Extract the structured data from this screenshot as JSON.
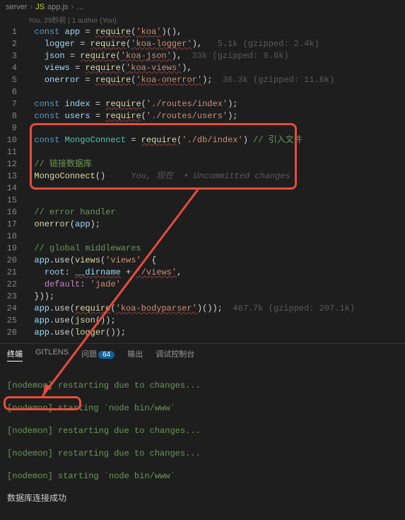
{
  "breadcrumb": {
    "folder": "server",
    "file": "app.js",
    "ellipsis": "…"
  },
  "authors": "You, 29秒前 | 1 author (You)",
  "code": {
    "l1": {
      "const": "const",
      "app": "app",
      "eq": " = ",
      "req": "require",
      "op": "(",
      "arg": "'koa'",
      "cp": ")(),"
    },
    "l2": {
      "logger": "logger",
      "eq": " = ",
      "req": "require",
      "op": "(",
      "arg": "'koa-logger'",
      "cp": "),",
      "hint": "   5.1k (gzipped: 2.4k)"
    },
    "l3": {
      "json": "json",
      "eq": " = ",
      "req": "require",
      "op": "(",
      "arg": "'koa-json'",
      "cp": "),",
      "hint": "  33k (gzipped: 9.6k)"
    },
    "l4": {
      "views": "views",
      "eq": " = ",
      "req": "require",
      "op": "(",
      "arg": "'koa-views'",
      "cp": "),"
    },
    "l5": {
      "onerror": "onerror",
      "eq": " = ",
      "req": "require",
      "op": "(",
      "arg": "'koa-onerror'",
      "cp": ");",
      "hint": "  36.3k (gzipped: 11.6k)"
    },
    "l7": {
      "const": "const",
      "index": "index",
      "eq": " = ",
      "req": "require",
      "op": "(",
      "arg": "'./routes/index'",
      "cp": ");"
    },
    "l8": {
      "const": "const",
      "users": "users",
      "eq": " = ",
      "req": "require",
      "op": "(",
      "arg": "'./routes/users'",
      "cp": ");"
    },
    "l10": {
      "const": "const",
      "mc": "MongoConnect",
      "eq": " = ",
      "req": "require",
      "op": "(",
      "arg": "'./db/index'",
      "cp": ")",
      "cmt": " // 引入文件"
    },
    "l12": {
      "cmt": "// 链接数据库"
    },
    "l13": {
      "mc": "MongoConnect",
      "call": "()",
      "lens": "     You, 现在  • Uncommitted changes"
    },
    "l16": {
      "cmt": "// error handler"
    },
    "l17": {
      "fn": "onerror",
      "op": "(",
      "arg": "app",
      "cp": ");"
    },
    "l19": {
      "cmt": "// global middlewares"
    },
    "l20": {
      "app": "app",
      "use": ".use(",
      "fn": "views",
      "op": "(",
      "arg": "'views'",
      "cm": ", {"
    },
    "l21": {
      "root": "root",
      "col": ": ",
      "dn": "__dirname",
      "plus": " + ",
      "arg": "'/views'",
      "cm": ","
    },
    "l22": {
      "default": "default",
      "col": ": ",
      "arg": "'jade'"
    },
    "l23": {
      "close": "}));"
    },
    "l24": {
      "app": "app",
      "use": ".use(",
      "req": "require",
      "op": "(",
      "arg": "'koa-bodyparser'",
      "cp": ")());",
      "hint": "  467.7k (gzipped: 207.1k)"
    },
    "l25": {
      "app": "app",
      "use": ".use(",
      "fn": "json",
      "cp": "());"
    },
    "l26": {
      "app": "app",
      "use": ".use(",
      "fn": "logger",
      "cp": "());"
    }
  },
  "panel": {
    "tabs": {
      "terminal": "终端",
      "gitlens": "GITLENS",
      "problems": "问题",
      "badge": "64",
      "output": "输出",
      "debug": "调试控制台"
    }
  },
  "terminal": [
    {
      "pre": "[nodemon] ",
      "msg": "restarting due to changes..."
    },
    {
      "pre": "[nodemon] ",
      "msg": "starting `node bin/www`"
    },
    {
      "pre": "[nodemon] ",
      "msg": "restarting due to changes..."
    },
    {
      "pre": "[nodemon] ",
      "msg": "restarting due to changes..."
    },
    {
      "pre": "[nodemon] ",
      "msg": "starting `node bin/www`"
    }
  ],
  "success": "数据库连接成功"
}
